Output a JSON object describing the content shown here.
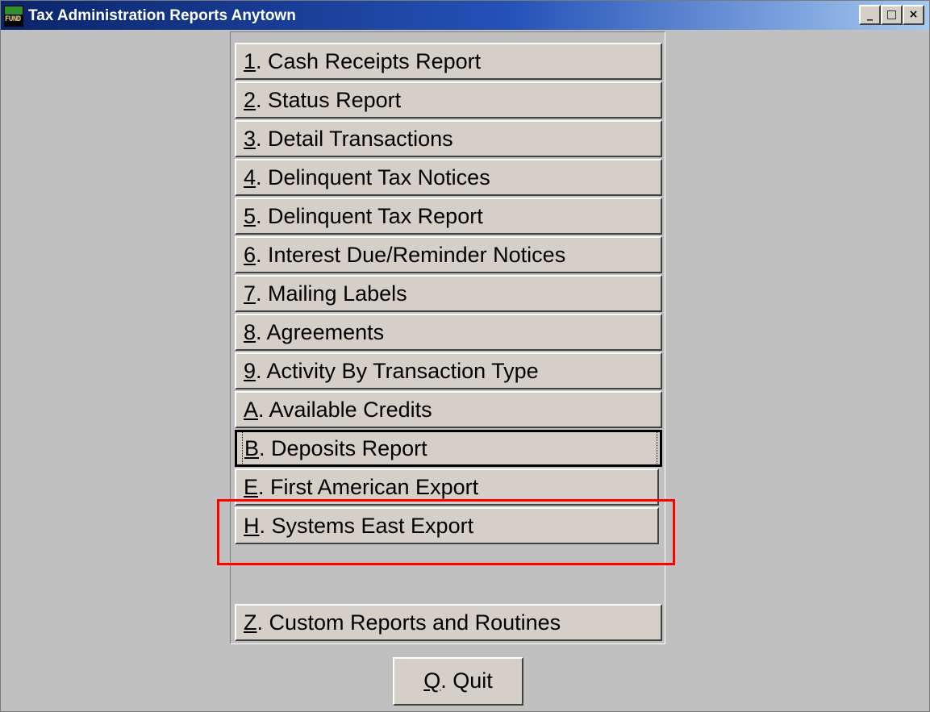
{
  "window": {
    "title": "Tax Administration Reports Anytown",
    "icon_text": "FUND",
    "controls": {
      "minimize": "_",
      "maximize": "□",
      "close": "×"
    }
  },
  "menu": {
    "items": [
      {
        "label": "1. Cash Receipts Report"
      },
      {
        "label": "2. Status Report"
      },
      {
        "label": "3. Detail Transactions"
      },
      {
        "label": "4. Delinquent Tax Notices"
      },
      {
        "label": "5. Delinquent Tax Report"
      },
      {
        "label": "6. Interest Due/Reminder Notices"
      },
      {
        "label": "7. Mailing Labels"
      },
      {
        "label": "8. Agreements"
      },
      {
        "label": "9. Activity By Transaction Type"
      },
      {
        "label": "A. Available Credits"
      },
      {
        "label": "B. Deposits Report",
        "focused": true
      },
      {
        "label": "E. First American Export"
      },
      {
        "label": "H. Systems East Export",
        "highlighted": true
      },
      {
        "label": "Z. Custom Reports and Routines"
      }
    ],
    "quit_label": "Q.  Quit"
  },
  "colors": {
    "highlight": "#ff0000",
    "face": "#d4d0c8",
    "background": "#c0c0c0"
  }
}
